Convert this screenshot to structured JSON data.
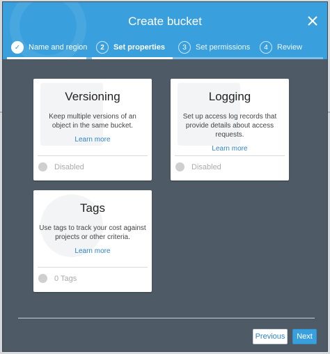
{
  "modal": {
    "title": "Create bucket",
    "steps": [
      {
        "num": "✓",
        "label": "Name and region",
        "state": "done"
      },
      {
        "num": "2",
        "label": "Set properties",
        "state": "active"
      },
      {
        "num": "3",
        "label": "Set permissions",
        "state": "todo"
      },
      {
        "num": "4",
        "label": "Review",
        "state": "todo"
      }
    ]
  },
  "cards": {
    "versioning": {
      "title": "Versioning",
      "description": "Keep multiple versions of an object in the same bucket.",
      "link": "Learn more",
      "status": "Disabled"
    },
    "logging": {
      "title": "Logging",
      "description": "Set up access log records that provide details about access requests.",
      "link": "Learn more",
      "status": "Disabled"
    },
    "tags": {
      "title": "Tags",
      "description": "Use tags to track your cost against projects or other criteria.",
      "link": "Learn more",
      "status": "0 Tags"
    }
  },
  "footer": {
    "previous_label": "Previous",
    "next_label": "Next"
  },
  "colors": {
    "header": "#3aa0dd",
    "body": "#4e5b66",
    "link": "#2f84c5"
  }
}
